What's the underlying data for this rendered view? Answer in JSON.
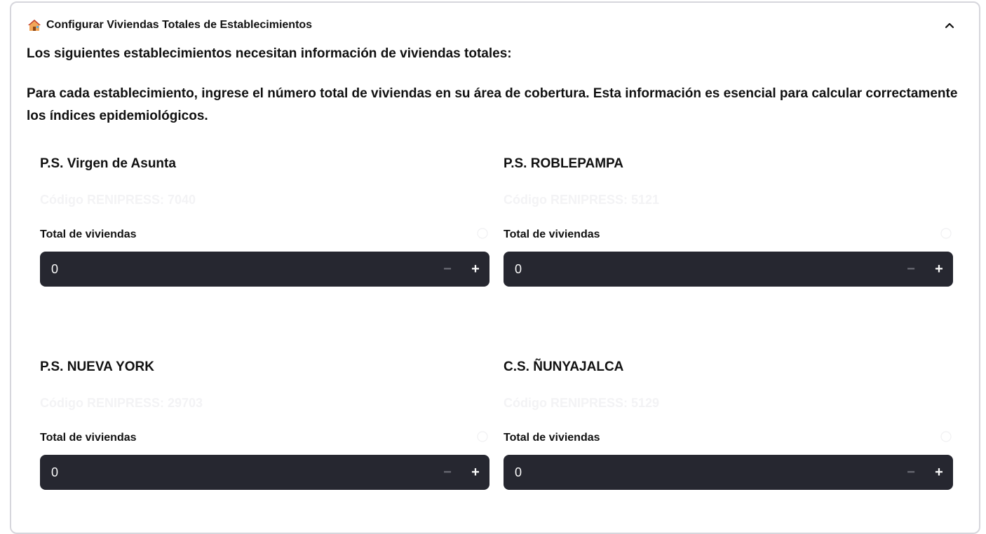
{
  "expander": {
    "title": "Configurar Viviendas Totales de Establecimientos",
    "icon": "house-icon",
    "state": "expanded"
  },
  "intro": {
    "line1": "Los siguientes establecimientos necesitan información de viviendas totales:",
    "line2": "Para cada establecimiento, ingrese el número total de viviendas en su área de cobertura. Esta información es esencial para calcular correctamente los índices epidemiológicos."
  },
  "establishments": [
    {
      "name": "P.S. Virgen de Asunta",
      "code": "Código RENIPRESS: 7040",
      "label": "Total de viviendas",
      "value": "0"
    },
    {
      "name": "P.S. ROBLEPAMPA",
      "code": "Código RENIPRESS: 5121",
      "label": "Total de viviendas",
      "value": "0"
    },
    {
      "name": "P.S. NUEVA YORK",
      "code": "Código RENIPRESS: 29703",
      "label": "Total de viviendas",
      "value": "0"
    },
    {
      "name": "C.S. ÑUNYAJALCA",
      "code": "Código RENIPRESS: 5129",
      "label": "Total de viviendas",
      "value": "0"
    }
  ],
  "stepper": {
    "minus": "−",
    "plus": "+"
  },
  "colors": {
    "input_bg": "#262730",
    "border": "#d6d6dc",
    "text": "#111111",
    "faint_text": "#f3f3f5"
  }
}
